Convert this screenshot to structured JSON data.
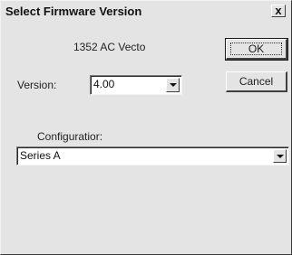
{
  "dialog": {
    "title": "Select Firmware Version",
    "close_icon": "close-icon",
    "close_glyph": "x"
  },
  "device": {
    "name": "1352 AC Vecto"
  },
  "version": {
    "label": "Version:",
    "value": "4.00"
  },
  "configuration": {
    "label": "Configuratior:",
    "value": "Series A"
  },
  "buttons": {
    "ok_label": "OK",
    "cancel_label": "Cancel"
  },
  "colors": {
    "window_bg": "#e4e4e4",
    "field_bg": "#ffffff"
  }
}
